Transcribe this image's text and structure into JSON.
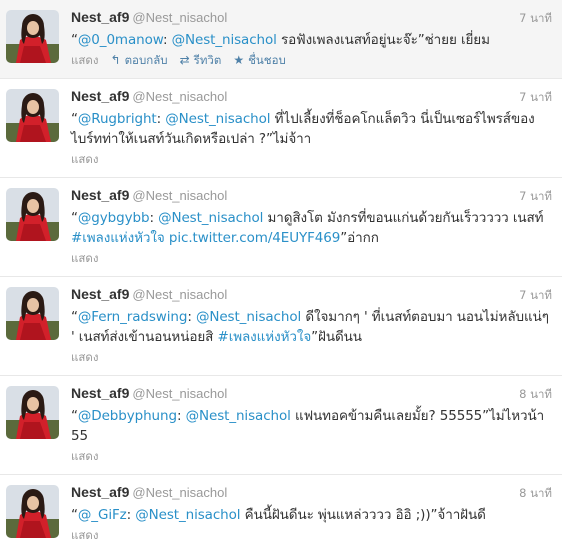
{
  "accent_color": "#2a90c8",
  "tweets": [
    {
      "name": "Nest_af9",
      "handle": "@Nest_nisachol",
      "time": "7 นาที",
      "segments": [
        {
          "t": "“",
          "link": false
        },
        {
          "t": "@0_0manow",
          "link": true
        },
        {
          "t": ": ",
          "link": false
        },
        {
          "t": "@Nest_nisachol",
          "link": true
        },
        {
          "t": " รอฟังเพลงเนสท์อยู่นะจ๊ะ”ช่ายย เยี่ยม",
          "link": false
        }
      ],
      "show": "แสดง",
      "reply": "ตอบกลับ",
      "retweet": "รีทวิต",
      "favorite": "ชื่นชอบ"
    },
    {
      "name": "Nest_af9",
      "handle": "@Nest_nisachol",
      "time": "7 นาที",
      "segments": [
        {
          "t": "“",
          "link": false
        },
        {
          "t": "@Rugbright",
          "link": true
        },
        {
          "t": ": ",
          "link": false
        },
        {
          "t": "@Nest_nisachol",
          "link": true
        },
        {
          "t": " ที่ไปเลี้ยงที่ช็อคโกแล็ตวิว นี่เป็นเซอร์ไพรส์ของไบร์ทท่าให้เนสท์วันเกิดหรือเปล่า ?”ไม่จ้าา",
          "link": false
        }
      ],
      "show": "แสดง"
    },
    {
      "name": "Nest_af9",
      "handle": "@Nest_nisachol",
      "time": "7 นาที",
      "segments": [
        {
          "t": "“",
          "link": false
        },
        {
          "t": "@gybgybb",
          "link": true
        },
        {
          "t": ": ",
          "link": false
        },
        {
          "t": "@Nest_nisachol",
          "link": true
        },
        {
          "t": " มาดูสิงโต มังกรที่ขอนแก่นด้วยกันเร็ววววว เนสท์ ",
          "link": false
        },
        {
          "t": "#เพลงแห่งหัวใจ",
          "link": true
        },
        {
          "t": " ",
          "link": false
        },
        {
          "t": "pic.twitter.com/4EUYF469",
          "link": true
        },
        {
          "t": "”อ่ากก",
          "link": false
        }
      ],
      "show": "แสดง"
    },
    {
      "name": "Nest_af9",
      "handle": "@Nest_nisachol",
      "time": "7 นาที",
      "segments": [
        {
          "t": "“",
          "link": false
        },
        {
          "t": "@Fern_radswing",
          "link": true
        },
        {
          "t": ": ",
          "link": false
        },
        {
          "t": "@Nest_nisachol",
          "link": true
        },
        {
          "t": " ดีใจมากๆ ' ที่เนสท์ตอบมา นอนไม่หลับแน่ๆ ' เนสท์ส่งเข้านอนหน่อยสิ ",
          "link": false
        },
        {
          "t": "#เพลงแห่งหัวใจ",
          "link": true
        },
        {
          "t": "”ฝันดีนน",
          "link": false
        }
      ],
      "show": "แสดง"
    },
    {
      "name": "Nest_af9",
      "handle": "@Nest_nisachol",
      "time": "8 นาที",
      "segments": [
        {
          "t": "“",
          "link": false
        },
        {
          "t": "@Debbyphung",
          "link": true
        },
        {
          "t": ": ",
          "link": false
        },
        {
          "t": "@Nest_nisachol",
          "link": true
        },
        {
          "t": " แฟนทอคข้ามคืนเลยมั้ย? 55555”ไม่ไหวน้า 55",
          "link": false
        }
      ],
      "show": "แสดง"
    },
    {
      "name": "Nest_af9",
      "handle": "@Nest_nisachol",
      "time": "8 นาที",
      "segments": [
        {
          "t": "“",
          "link": false
        },
        {
          "t": "@_GiFz",
          "link": true
        },
        {
          "t": ": ",
          "link": false
        },
        {
          "t": "@Nest_nisachol",
          "link": true
        },
        {
          "t": " คืนนี้ฝันดีนะ พุ่นแหล่วววว อิอิ ;))”จ้าาฝันดี",
          "link": false
        }
      ],
      "show": "แสดง"
    }
  ]
}
